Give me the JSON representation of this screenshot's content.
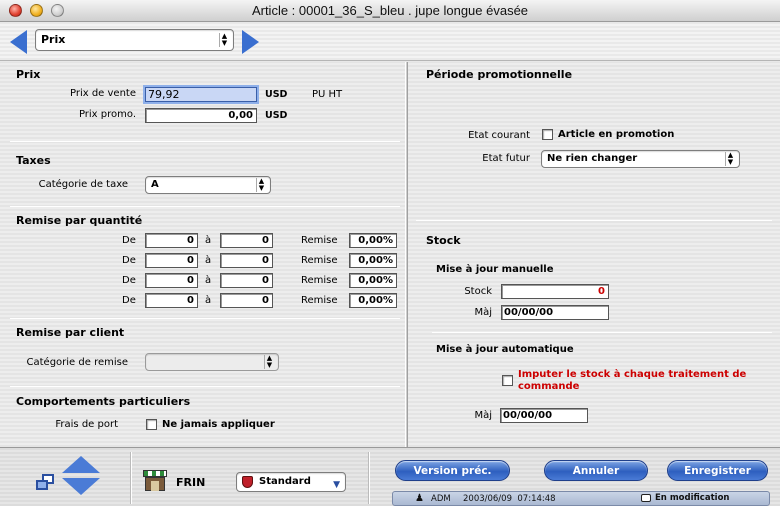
{
  "window": {
    "title": "Article : 00001_36_S_bleu . jupe longue évasée"
  },
  "nav": {
    "section_select": "Prix"
  },
  "prix": {
    "heading": "Prix",
    "prix_vente_label": "Prix de vente",
    "prix_vente_value": "79,92",
    "prix_vente_currency": "USD",
    "pu_ht": "PU HT",
    "prix_promo_label": "Prix promo.",
    "prix_promo_value": "0,00",
    "prix_promo_currency": "USD"
  },
  "taxes": {
    "heading": "Taxes",
    "categorie_label": "Catégorie de taxe",
    "categorie_value": "A"
  },
  "remise_quantite": {
    "heading": "Remise par quantité",
    "rows": [
      {
        "de_label": "De",
        "de": "0",
        "a_label": "à",
        "a": "0",
        "remise_label": "Remise",
        "remise": "0,00%"
      },
      {
        "de_label": "De",
        "de": "0",
        "a_label": "à",
        "a": "0",
        "remise_label": "Remise",
        "remise": "0,00%"
      },
      {
        "de_label": "De",
        "de": "0",
        "a_label": "à",
        "a": "0",
        "remise_label": "Remise",
        "remise": "0,00%"
      },
      {
        "de_label": "De",
        "de": "0",
        "a_label": "à",
        "a": "0",
        "remise_label": "Remise",
        "remise": "0,00%"
      }
    ]
  },
  "remise_client": {
    "heading": "Remise par client",
    "categorie_label": "Catégorie de remise",
    "categorie_value": ""
  },
  "comportements": {
    "heading": "Comportements particuliers",
    "frais_label": "Frais de port",
    "frais_checkbox": "Ne jamais appliquer"
  },
  "promo": {
    "heading": "Période promotionnelle",
    "etat_courant_label": "Etat courant",
    "etat_courant_checkbox": "Article en promotion",
    "etat_futur_label": "Etat futur",
    "etat_futur_value": "Ne rien changer"
  },
  "stock": {
    "heading": "Stock",
    "manuel_heading": "Mise à jour manuelle",
    "stock_label": "Stock",
    "stock_value": "0",
    "maj_label": "Màj",
    "maj_value": "00/00/00",
    "auto_heading": "Mise à jour automatique",
    "imputer_checkbox": "Imputer le stock à chaque traitement de commande",
    "maj_auto_label": "Màj",
    "maj_auto_value": "00/00/00"
  },
  "bottom": {
    "store_code": "FRIN",
    "mode_select": "Standard",
    "btn_prev": "Version préc.",
    "btn_cancel": "Annuler",
    "btn_save": "Enregistrer"
  },
  "status": {
    "user": "ADM",
    "datetime": "2003/06/09  07:14:48",
    "mode": "En modification"
  },
  "colors": {
    "accent_blue": "#2e5fbf",
    "alert_red": "#cc0000",
    "highlight_field": "#c9d7f5"
  }
}
